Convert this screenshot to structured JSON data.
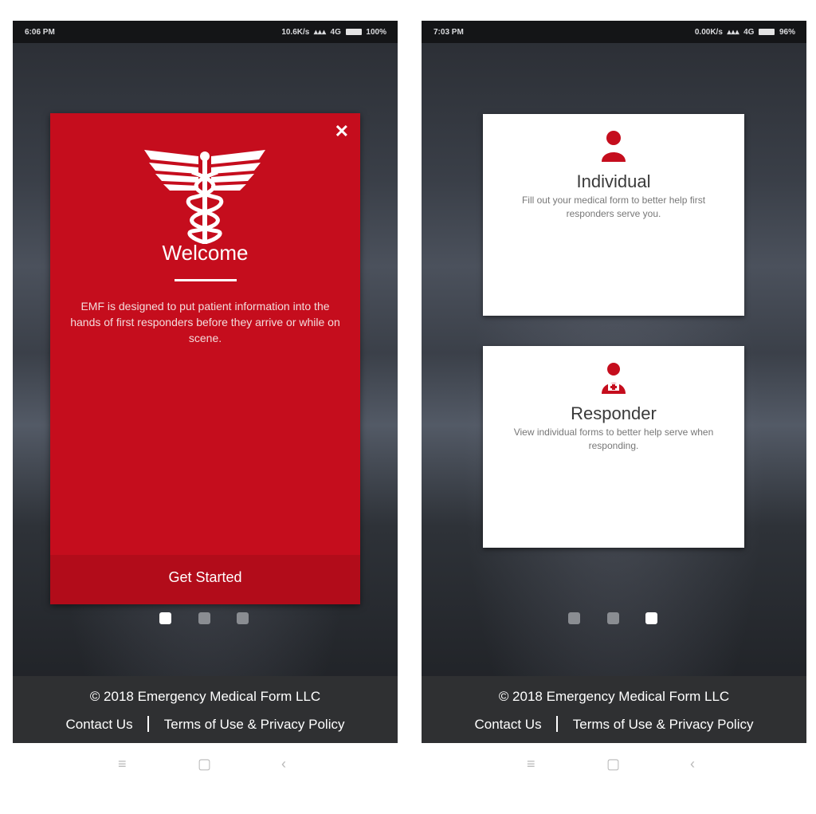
{
  "colors": {
    "brand_red": "#c50d1d",
    "footer_bg": "#2f3032",
    "status_bg": "#141517",
    "dot_active": "#ffffff",
    "dot_inactive": "#8a8d92"
  },
  "left_screen": {
    "status": {
      "time": "6:06 PM",
      "speed": "10.6K/s",
      "network": "4G",
      "battery": "100%",
      "battery_icon": "battery-icon"
    },
    "welcome": {
      "close_icon": "close-icon",
      "logo_icon": "caduceus-icon",
      "title": "Welcome",
      "description": "EMF is designed to put patient information into the hands of first responders before they arrive or while on scene.",
      "button_label": "Get Started"
    },
    "pager": {
      "count": 3,
      "active": 0
    }
  },
  "right_screen": {
    "status": {
      "time": "7:03 PM",
      "speed": "0.00K/s",
      "network": "4G",
      "battery": "96%",
      "battery_icon": "battery-icon"
    },
    "cards": [
      {
        "title": "Individual",
        "description": "Fill out your medical form to better help first responders serve you.",
        "icon": "person-icon"
      },
      {
        "title": "Responder",
        "description": "View individual forms to better help serve when responding.",
        "icon": "medic-icon"
      }
    ],
    "pager": {
      "count": 3,
      "active": 2
    }
  },
  "footer": {
    "copyright": "© 2018 Emergency Medical Form LLC",
    "contact": "Contact Us",
    "terms": "Terms of Use & Privacy Policy"
  },
  "navbar": {
    "menu_icon": "≡",
    "home_icon": "▢",
    "back_icon": "‹"
  }
}
